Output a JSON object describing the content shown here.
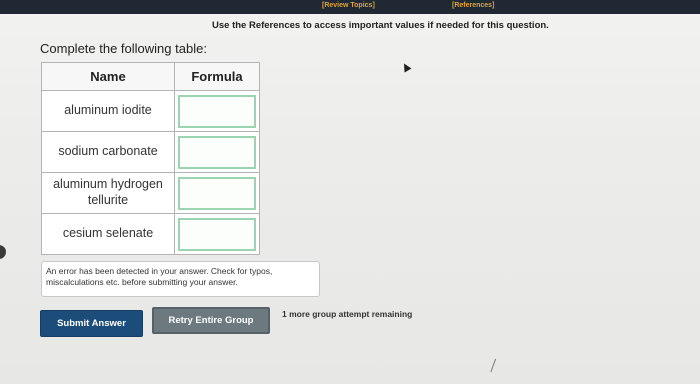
{
  "header": {
    "review_topics": "[Review Topics]",
    "references": "[References]"
  },
  "instructions": "Use the References to access important values if needed for this question.",
  "prompt": "Complete the following table:",
  "table": {
    "headers": {
      "name": "Name",
      "formula": "Formula"
    },
    "rows": [
      {
        "name": "aluminum iodite",
        "formula": ""
      },
      {
        "name": "sodium carbonate",
        "formula": ""
      },
      {
        "name": "aluminum hydrogen tellurite",
        "formula": ""
      },
      {
        "name": "cesium selenate",
        "formula": ""
      }
    ]
  },
  "error_message": "An error has been detected in your answer. Check for typos, miscalculations etc. before submitting your answer.",
  "buttons": {
    "submit": "Submit Answer",
    "retry": "Retry Entire Group"
  },
  "attempts_remaining": "1 more group attempt remaining",
  "colors": {
    "topbar": "#1f2833",
    "link": "#e0a43a",
    "submit_bg": "#1c4c7a",
    "retry_bg": "#6c7a80",
    "input_border": "#9bd4b0"
  }
}
